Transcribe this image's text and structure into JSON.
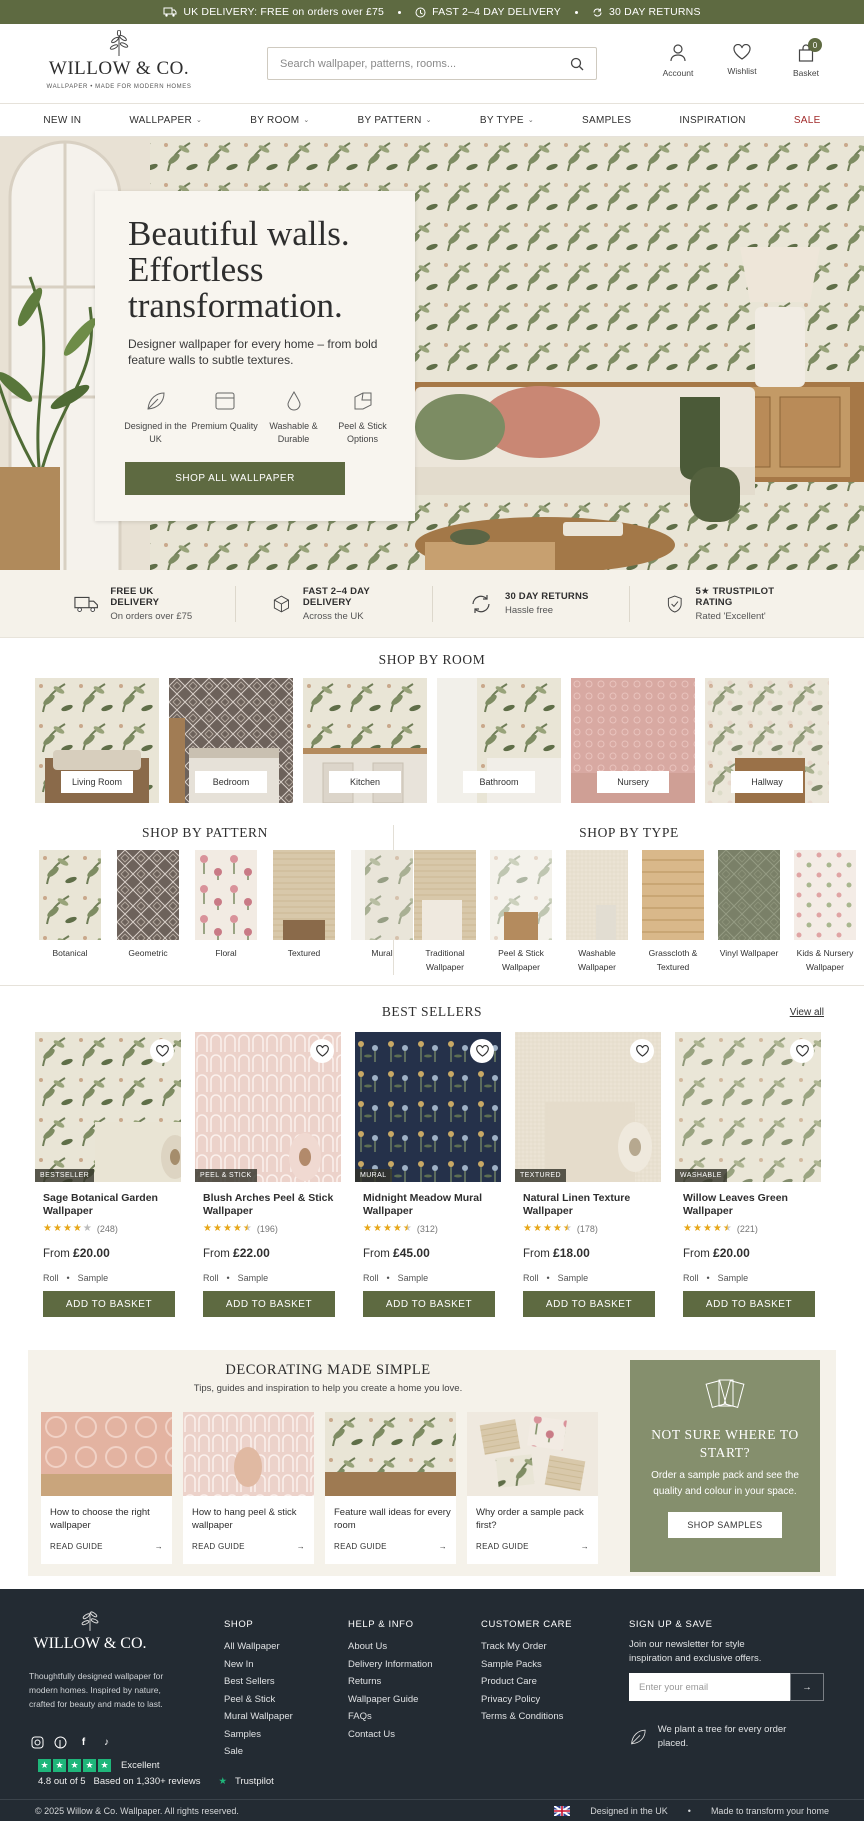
{
  "topbar": {
    "items": [
      "UK DELIVERY: FREE on orders over £75",
      "FAST 2–4 DAY DELIVERY",
      "30 DAY RETURNS"
    ]
  },
  "brand": {
    "name": "WILLOW & CO.",
    "tagline": "WALLPAPER • MADE FOR MODERN HOMES"
  },
  "search": {
    "placeholder": "Search wallpaper, patterns, rooms..."
  },
  "header_icons": {
    "account": "Account",
    "wishlist": "Wishlist",
    "basket": "Basket",
    "basket_count": "0"
  },
  "nav": [
    "NEW IN",
    "WALLPAPER",
    "BY ROOM",
    "BY PATTERN",
    "BY TYPE",
    "SAMPLES",
    "INSPIRATION",
    "SALE"
  ],
  "hero": {
    "title": "Beautiful walls. Effortless transformation.",
    "subtitle": "Designer wallpaper for every home – from bold feature walls to subtle textures.",
    "features": [
      "Designed in the UK",
      "Premium Quality",
      "Washable & Durable",
      "Peel & Stick Options"
    ],
    "cta": "SHOP ALL WALLPAPER"
  },
  "usp": [
    {
      "title": "FREE UK DELIVERY",
      "sub": "On orders over £75"
    },
    {
      "title": "FAST 2–4 DAY DELIVERY",
      "sub": "Across the UK"
    },
    {
      "title": "30 DAY RETURNS",
      "sub": "Hassle free"
    },
    {
      "title": "5★ TRUSTPILOT RATING",
      "sub": "Rated 'Excellent'"
    }
  ],
  "shop_by_room": {
    "title": "SHOP BY ROOM",
    "rooms": [
      "Living Room",
      "Bedroom",
      "Kitchen",
      "Bathroom",
      "Nursery",
      "Hallway"
    ]
  },
  "shop_by_pattern": {
    "title": "SHOP BY PATTERN",
    "items": [
      "Botanical",
      "Geometric",
      "Floral",
      "Textured",
      "Mural"
    ]
  },
  "shop_by_type": {
    "title": "SHOP BY TYPE",
    "items": [
      "Traditional Wallpaper",
      "Peel & Stick Wallpaper",
      "Washable Wallpaper",
      "Grasscloth & Textured",
      "Vinyl Wallpaper",
      "Kids & Nursery Wallpaper"
    ]
  },
  "best_sellers": {
    "title": "BEST SELLERS",
    "view_all": "View all",
    "price_prefix": "From",
    "roll": "Roll",
    "sample": "Sample",
    "add_label": "ADD TO BASKET",
    "products": [
      {
        "tag": "BESTSELLER",
        "name": "Sage Botanical Garden Wallpaper",
        "rating": 4,
        "reviews": "(248)",
        "price": "£20.00"
      },
      {
        "tag": "PEEL & STICK",
        "name": "Blush Arches Peel & Stick Wallpaper",
        "rating": 4.5,
        "reviews": "(196)",
        "price": "£22.00"
      },
      {
        "tag": "MURAL",
        "name": "Midnight Meadow Mural Wallpaper",
        "rating": 4.5,
        "reviews": "(312)",
        "price": "£45.00"
      },
      {
        "tag": "TEXTURED",
        "name": "Natural Linen Texture Wallpaper",
        "rating": 4.5,
        "reviews": "(178)",
        "price": "£18.00"
      },
      {
        "tag": "WASHABLE",
        "name": "Willow Leaves Green Wallpaper",
        "rating": 4.5,
        "reviews": "(221)",
        "price": "£20.00"
      }
    ]
  },
  "decorating": {
    "title": "DECORATING MADE SIMPLE",
    "subtitle": "Tips, guides and inspiration to help you create a home you love.",
    "read": "READ GUIDE",
    "guides": [
      "How to choose the right wallpaper",
      "How to hang peel & stick wallpaper",
      "Feature wall ideas for every room",
      "Why order a sample pack first?"
    ]
  },
  "samples_panel": {
    "title": "NOT SURE WHERE TO START?",
    "text": "Order a sample pack and see the quality and colour in your space.",
    "cta": "SHOP SAMPLES"
  },
  "footer": {
    "about": "Thoughtfully designed wallpaper for modern homes. Inspired by nature, crafted for beauty and made to last.",
    "cols": [
      {
        "title": "SHOP",
        "links": [
          "All Wallpaper",
          "New In",
          "Best Sellers",
          "Peel & Stick",
          "Mural Wallpaper",
          "Samples",
          "Sale"
        ]
      },
      {
        "title": "HELP & INFO",
        "links": [
          "About Us",
          "Delivery Information",
          "Returns",
          "Wallpaper Guide",
          "FAQs",
          "Contact Us"
        ]
      },
      {
        "title": "CUSTOMER CARE",
        "links": [
          "Track My Order",
          "Sample Packs",
          "Product Care",
          "Privacy Policy",
          "Terms & Conditions"
        ]
      }
    ],
    "signup": {
      "title": "SIGN UP & SAVE",
      "text": "Join our newsletter for style inspiration and exclusive offers.",
      "placeholder": "Enter your email",
      "tree": "We plant a tree for every order placed."
    },
    "trustpilot": {
      "label": "Excellent",
      "score": "4.8 out of 5",
      "reviews": "Based on 1,330+ reviews",
      "brand": "Trustpilot"
    },
    "copyright": "© 2025 Willow & Co. Wallpaper. All rights reserved.",
    "designed": "Designed in the UK",
    "made": "Made to transform your home"
  },
  "colors": {
    "brand_green": "#5e6a41",
    "sage_panel": "#858f6d",
    "footer_bg": "#232b33",
    "sale_red": "#a12a2a",
    "star": "#e6a71a",
    "trustpilot": "#1fb67a"
  }
}
